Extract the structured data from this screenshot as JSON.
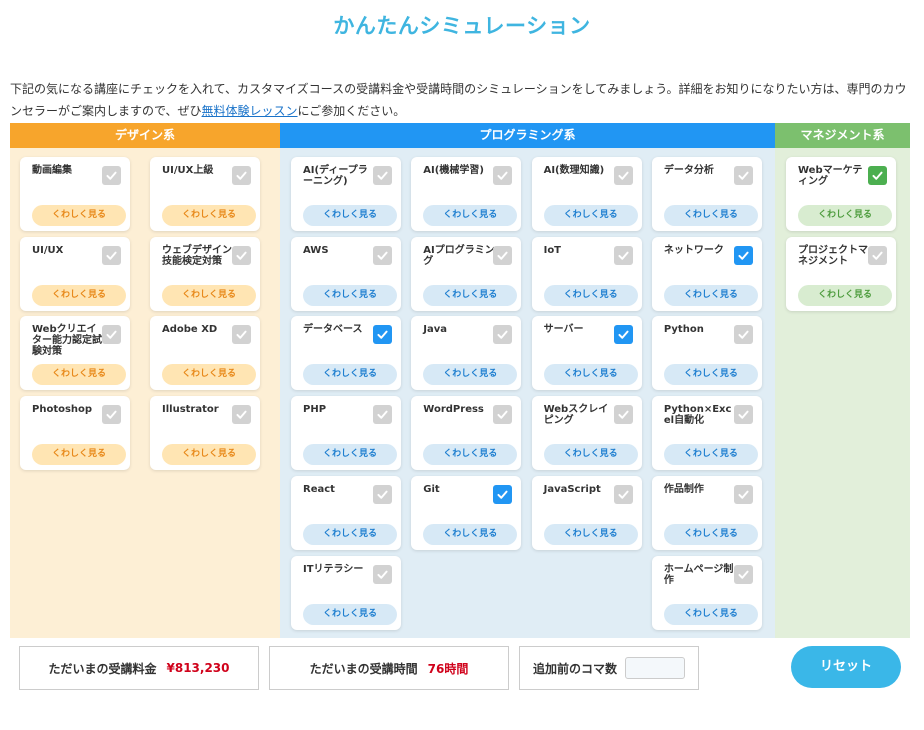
{
  "page": {
    "title": "かんたんシミュレーション",
    "intro_before": "下記の気になる講座にチェックを入れて、カスタマイズコースの受講料金や受講時間のシミュレーションをしてみましょう。詳細をお知りになりたい方は、専門のカウンセラーがご案内しますので、ぜひ",
    "intro_link": "無料体験レッスン",
    "intro_after": "にご参加ください。"
  },
  "categories": {
    "design": {
      "label": "デザイン系"
    },
    "programming": {
      "label": "プログラミング系"
    },
    "management": {
      "label": "マネジメント系"
    }
  },
  "more_label": "くわしく見る",
  "courses": {
    "design": [
      {
        "name": "動画編集",
        "checked": false
      },
      {
        "name": "UI/UX上級",
        "checked": false
      },
      {
        "name": "UI/UX",
        "checked": false
      },
      {
        "name": "ウェブデザイン技能検定対策",
        "checked": false
      },
      {
        "name": "Webクリエイター能力認定試験対策",
        "checked": false
      },
      {
        "name": "Adobe XD",
        "checked": false
      },
      {
        "name": "Photoshop",
        "checked": false
      },
      {
        "name": "Illustrator",
        "checked": false
      }
    ],
    "programming": [
      {
        "name": "AI(ディープラーニング)",
        "checked": false
      },
      {
        "name": "AI(機械学習)",
        "checked": false
      },
      {
        "name": "AI(数理知識)",
        "checked": false
      },
      {
        "name": "データ分析",
        "checked": false
      },
      {
        "name": "AWS",
        "checked": false
      },
      {
        "name": "AIプログラミング",
        "checked": false
      },
      {
        "name": "IoT",
        "checked": false
      },
      {
        "name": "ネットワーク",
        "checked": true
      },
      {
        "name": "データベース",
        "checked": true
      },
      {
        "name": "Java",
        "checked": false
      },
      {
        "name": "サーバー",
        "checked": true
      },
      {
        "name": "Python",
        "checked": false
      },
      {
        "name": "PHP",
        "checked": false
      },
      {
        "name": "WordPress",
        "checked": false
      },
      {
        "name": "Webスクレイピング",
        "checked": false
      },
      {
        "name": "Python×Excel自動化",
        "checked": false
      },
      {
        "name": "React",
        "checked": false
      },
      {
        "name": "Git",
        "checked": true
      },
      {
        "name": "JavaScript",
        "checked": false
      },
      {
        "name": "作品制作",
        "checked": false
      },
      {
        "name": "ITリテラシー",
        "checked": false
      },
      {
        "name": "ホームページ制作",
        "checked": false
      }
    ],
    "management": [
      {
        "name": "Webマーケティング",
        "checked": true
      },
      {
        "name": "プロジェクトマネジメント",
        "checked": false
      }
    ]
  },
  "summary": {
    "fee_label": "ただいまの受講料金",
    "fee_value": "¥813,230",
    "time_label": "ただいまの受講時間",
    "time_value": "76時間",
    "lessons_label": "追加前のコマ数",
    "lessons_value": ""
  },
  "reset_label": "リセット",
  "colors": {
    "title": "#3fb5e0",
    "design": "#f7a52c",
    "programming": "#2196f3",
    "management": "#7cc06e",
    "price": "#d0021b",
    "reset": "#3ab7e8"
  }
}
